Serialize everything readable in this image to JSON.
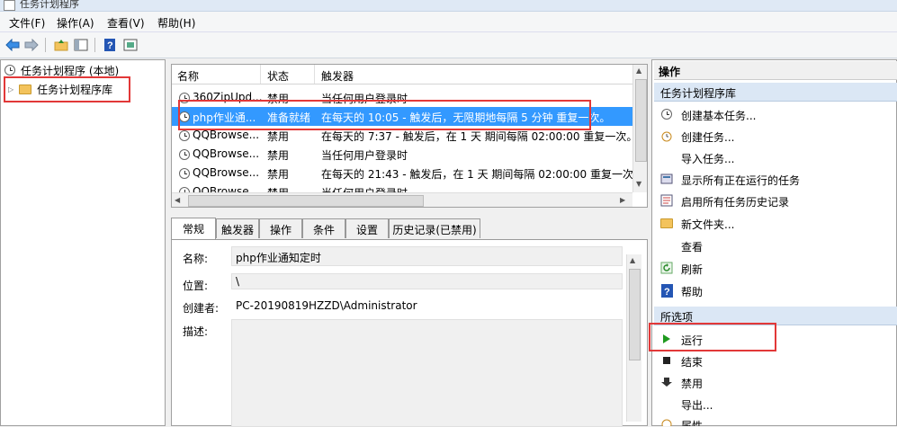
{
  "window": {
    "title": "任务计划程序"
  },
  "menu": [
    "文件(F)",
    "操作(A)",
    "查看(V)",
    "帮助(H)"
  ],
  "toolbar": {
    "icons": [
      "back-arrow-icon",
      "forward-arrow-icon",
      "folder-up-icon",
      "show-hide-tree-icon",
      "help-icon",
      "console-icon"
    ]
  },
  "tree": {
    "root": "任务计划程序 (本地)",
    "child": "任务计划程序库"
  },
  "list": {
    "columns": [
      "名称",
      "状态",
      "触发器"
    ],
    "rows": [
      {
        "name": "360ZipUpd...",
        "status": "禁用",
        "trigger": "当任何用户登录时"
      },
      {
        "name": "php作业通...",
        "status": "准备就绪",
        "trigger": "在每天的 10:05 - 触发后，无限期地每隔 5 分钟 重复一次。"
      },
      {
        "name": "QQBrowse...",
        "status": "禁用",
        "trigger": "在每天的 7:37 - 触发后，在 1 天 期间每隔 02:00:00 重复一次。"
      },
      {
        "name": "QQBrowse...",
        "status": "禁用",
        "trigger": "当任何用户登录时"
      },
      {
        "name": "QQBrowse...",
        "status": "禁用",
        "trigger": "在每天的 21:43 - 触发后，在 1 天 期间每隔 02:00:00 重复一次。"
      },
      {
        "name": "QQBrowse...",
        "status": "禁用",
        "trigger": "当任何用户登录时"
      }
    ],
    "selected_index": 1
  },
  "detail": {
    "tabs": [
      "常规",
      "触发器",
      "操作",
      "条件",
      "设置",
      "历史记录(已禁用)"
    ],
    "active_tab": 0,
    "fields": {
      "name_label": "名称:",
      "name_value": "php作业通知定时",
      "location_label": "位置:",
      "location_value": "\\",
      "author_label": "创建者:",
      "author_value": "PC-20190819HZZD\\Administrator",
      "desc_label": "描述:"
    }
  },
  "actions": {
    "title": "操作",
    "section1": "任务计划程序库",
    "items1": [
      {
        "label": "创建基本任务...",
        "icon": "create-basic-task-icon"
      },
      {
        "label": "创建任务...",
        "icon": "create-task-icon"
      },
      {
        "label": "导入任务...",
        "icon": ""
      },
      {
        "label": "显示所有正在运行的任务",
        "icon": "running-tasks-icon"
      },
      {
        "label": "启用所有任务历史记录",
        "icon": "history-icon"
      },
      {
        "label": "新文件夹...",
        "icon": "new-folder-icon"
      },
      {
        "label": "查看",
        "icon": ""
      },
      {
        "label": "刷新",
        "icon": "refresh-icon"
      },
      {
        "label": "帮助",
        "icon": "help-icon"
      }
    ],
    "section2": "所选项",
    "items2": [
      {
        "label": "运行",
        "icon": "run-icon"
      },
      {
        "label": "结束",
        "icon": "stop-icon"
      },
      {
        "label": "禁用",
        "icon": "disable-icon"
      },
      {
        "label": "导出...",
        "icon": ""
      },
      {
        "label": "属性",
        "icon": "properties-icon"
      }
    ]
  },
  "colors": {
    "selection": "#3399ff",
    "highlight_box": "#e23838",
    "action_header": "#dbe7f5"
  }
}
